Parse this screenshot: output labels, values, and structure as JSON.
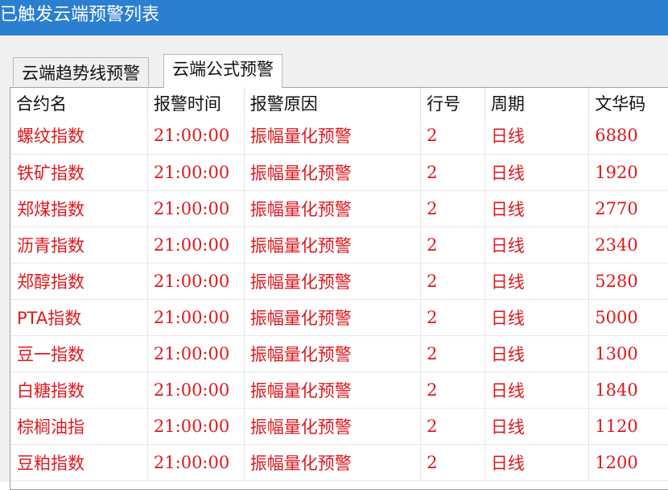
{
  "window": {
    "title": "已触发云端预警列表"
  },
  "tabs": [
    {
      "label": "云端趋势线预警",
      "active": false
    },
    {
      "label": "云端公式预警",
      "active": true
    }
  ],
  "table": {
    "columns": [
      "合约名",
      "报警时间",
      "报警原因",
      "行号",
      "周期",
      "文华码"
    ],
    "rows": [
      {
        "name": "螺纹指数",
        "time": "21:00:00",
        "reason": "振幅量化预警",
        "line": "2",
        "period": "日线",
        "code": "6880"
      },
      {
        "name": "铁矿指数",
        "time": "21:00:00",
        "reason": "振幅量化预警",
        "line": "2",
        "period": "日线",
        "code": "1920"
      },
      {
        "name": "郑煤指数",
        "time": "21:00:00",
        "reason": "振幅量化预警",
        "line": "2",
        "period": "日线",
        "code": "2770"
      },
      {
        "name": "沥青指数",
        "time": "21:00:00",
        "reason": "振幅量化预警",
        "line": "2",
        "period": "日线",
        "code": "2340"
      },
      {
        "name": "郑醇指数",
        "time": "21:00:00",
        "reason": "振幅量化预警",
        "line": "2",
        "period": "日线",
        "code": "5280"
      },
      {
        "name": "PTA指数",
        "time": "21:00:00",
        "reason": "振幅量化预警",
        "line": "2",
        "period": "日线",
        "code": "5000"
      },
      {
        "name": "豆一指数",
        "time": "21:00:00",
        "reason": "振幅量化预警",
        "line": "2",
        "period": "日线",
        "code": "1300"
      },
      {
        "name": "白糖指数",
        "time": "21:00:00",
        "reason": "振幅量化预警",
        "line": "2",
        "period": "日线",
        "code": "1840"
      },
      {
        "name": "棕榈油指",
        "time": "21:00:00",
        "reason": "振幅量化预警",
        "line": "2",
        "period": "日线",
        "code": "1120"
      },
      {
        "name": "豆粕指数",
        "time": "21:00:00",
        "reason": "振幅量化预警",
        "line": "2",
        "period": "日线",
        "code": "1200"
      }
    ]
  },
  "colors": {
    "titlebar": "#2b7fd0",
    "alert_text": "#e0181e"
  }
}
